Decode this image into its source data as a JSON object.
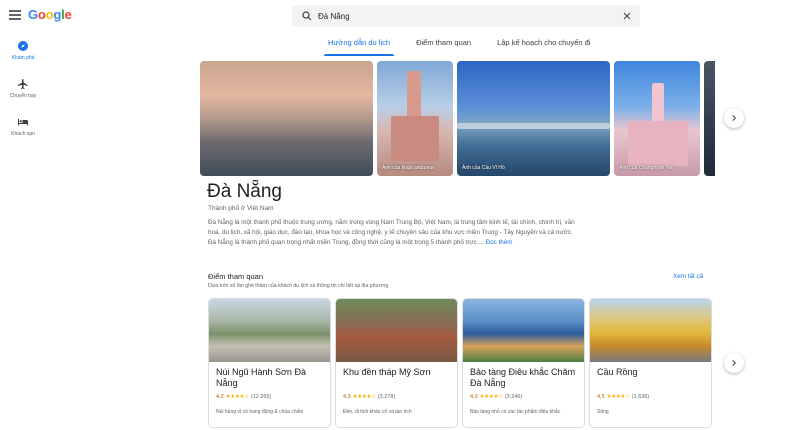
{
  "app": {
    "logo": "Google"
  },
  "search": {
    "value": "Đà Nẵng"
  },
  "tabs": [
    {
      "label": "Hướng dẫn du lịch",
      "active": true
    },
    {
      "label": "Điểm tham quan",
      "active": false
    },
    {
      "label": "Lập kế hoạch cho chuyến đi",
      "active": false
    }
  ],
  "sidebar": {
    "items": [
      {
        "label": "Khám phá",
        "icon": "explore-icon",
        "active": true
      },
      {
        "label": "Chuyến bay",
        "icon": "flight-icon",
        "active": false
      },
      {
        "label": "Khách sạn",
        "icon": "hotel-icon",
        "active": false
      }
    ]
  },
  "hero": {
    "photos": [
      {
        "caption": ""
      },
      {
        "caption": "Ảnh của krabi andaman"
      },
      {
        "caption": "Ảnh của Cầu Vĩ Hồ"
      },
      {
        "caption": "Ảnh của Changhyun Yoo"
      },
      {
        "caption": ""
      }
    ]
  },
  "destination": {
    "title": "Đà Nẵng",
    "subtitle": "Thành phố ở Việt Nam",
    "description": "Đà Nẵng là một thành phố thuộc trung ương, nằm trong vùng Nam Trung Bộ, Việt Nam, là trung tâm kinh tế, tài chính, chính trị, văn hoá, du lịch, xã hội, giáo dục, đào tạo, khoa học và công nghệ, y tế chuyên sâu của khu vực miền Trung - Tây Nguyên và cả nước. Đà Nẵng là thành phố quan trọng nhất miền Trung, đồng thời cũng là một trong 5 thành phố trực ...",
    "more": "Đọc thêm"
  },
  "attractions": {
    "heading": "Điểm tham quan",
    "subheading": "Dựa trên số lần ghé thăm của khách du lịch và thông tin chi tiết tại địa phương",
    "see_all": "Xem tất cả",
    "cards": [
      {
        "name": "Núi Ngũ Hành Sơn Đà Nẵng",
        "rating": "4,2",
        "stars": "★★★★☆",
        "reviews": "(12.265)",
        "desc": "Núi hùng vĩ có hang động & chùa chiền"
      },
      {
        "name": "Khu đền tháp Mỹ Sơn",
        "rating": "4,3",
        "stars": "★★★★☆",
        "reviews": "(3.278)",
        "desc": "Đền, di tích khảo cổ và tàn tích"
      },
      {
        "name": "Bảo tàng Điêu khắc Chăm Đà Nẵng",
        "rating": "4,0",
        "stars": "★★★★☆",
        "reviews": "(3.246)",
        "desc": "Bảo tàng nhỏ có các tác phẩm điêu khắc"
      },
      {
        "name": "Cầu Rồng",
        "rating": "4,5",
        "stars": "★★★★☆",
        "reviews": "(1.636)",
        "desc": "Sông"
      }
    ]
  },
  "colors": {
    "accent": "#1a73e8",
    "star": "#f9ab00"
  }
}
